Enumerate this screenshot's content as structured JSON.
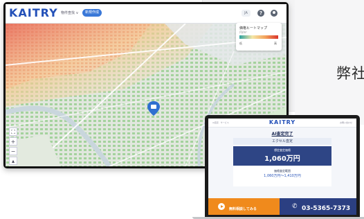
{
  "background": {
    "heading_fragment": "弊社"
  },
  "dashboard": {
    "brand": "KAITRY",
    "nav_dropdown": "物件查找 ∨",
    "nav_button": "新規作成",
    "lang": "JA",
    "help_icon": "help-icon",
    "user_icon": "user-icon",
    "legend": {
      "title": "価格ヒートマップ",
      "subtitle": "円/m²",
      "low": "低",
      "high": "高"
    },
    "map_tools": [
      "⛶",
      "+",
      "−",
      "▴"
    ]
  },
  "laptop": {
    "brand": "KAITRY",
    "nav_links_left": "AI査定 · サービス",
    "nav_links_right": "お問い合わせ",
    "title": "AI査定完了",
    "section": "エクセル査定",
    "result_label": "想定査定価格",
    "result_value": "1,060万円",
    "result_note": "",
    "range_label": "価格査定範囲",
    "range_value": "1,060万円〜1,410万円",
    "range_note": "",
    "cta_note": "",
    "cta_text": "無料相談してみる",
    "phone_note": "",
    "phone": "03-5365-7373"
  },
  "colors": {
    "brand_blue": "#2451b8",
    "navy": "#2e4585",
    "orange": "#f08a1c"
  }
}
